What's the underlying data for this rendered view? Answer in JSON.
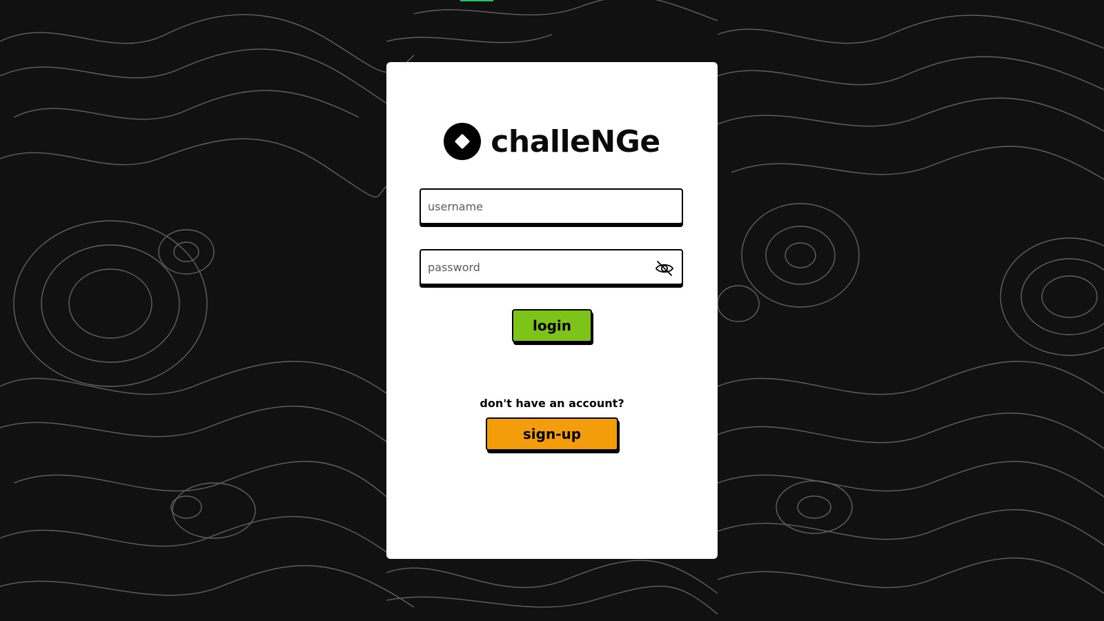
{
  "brand": {
    "name": "challeNGe",
    "logo_icon": "diamond-logo-icon"
  },
  "login_form": {
    "username_placeholder": "username",
    "username_value": "",
    "password_placeholder": "password",
    "password_value": "",
    "password_toggle_icon": "eye-off-icon",
    "login_label": "login"
  },
  "signup": {
    "prompt": "don't have an account?",
    "button_label": "sign-up"
  },
  "colors": {
    "background": "#111111",
    "card": "#ffffff",
    "login_button": "#7ec31a",
    "signup_button": "#f49d0c",
    "progress_accent": "#22c55e"
  }
}
